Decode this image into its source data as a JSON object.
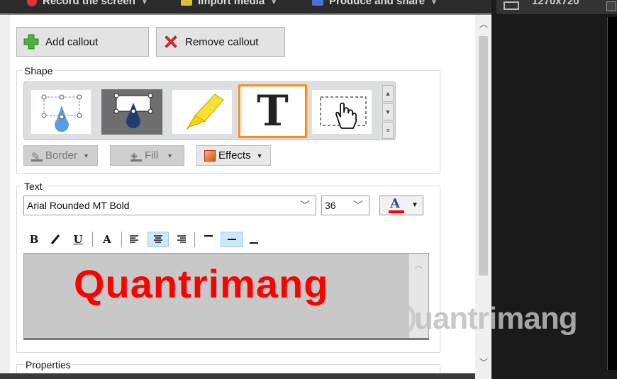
{
  "topbar": {
    "record": "Record the screen",
    "import": "Import media",
    "produce": "Produce and share",
    "right_text": "1270x720"
  },
  "callout": {
    "add_label": "Add callout",
    "remove_label": "Remove callout"
  },
  "shape": {
    "label": "Shape",
    "tiles": [
      "shape-callout",
      "shape-callout-dark",
      "highlight",
      "text",
      "spotlight"
    ],
    "text_tile_glyph": "T"
  },
  "style_buttons": {
    "border": "Border",
    "fill": "Fill",
    "effects": "Effects"
  },
  "text": {
    "label": "Text",
    "font_family": "Arial Rounded MT Bold",
    "font_size": "36",
    "font_color": "#ff0000",
    "content": "Quantrimang"
  },
  "format_toolbar": {
    "bold": "B",
    "italic": "I",
    "underline": "U",
    "font_effect": "A",
    "align_left_active": false,
    "align_center_active": true,
    "align_right_active": false,
    "valign_top_active": false,
    "valign_middle_active": true,
    "valign_bottom_active": false
  },
  "properties": {
    "label": "Properties"
  },
  "watermark": {
    "text": "uantrimang"
  },
  "colors": {
    "selection_orange": "#ff8c1a",
    "callout_text_red": "#ff0000",
    "active_blue": "#cfe6f7"
  }
}
